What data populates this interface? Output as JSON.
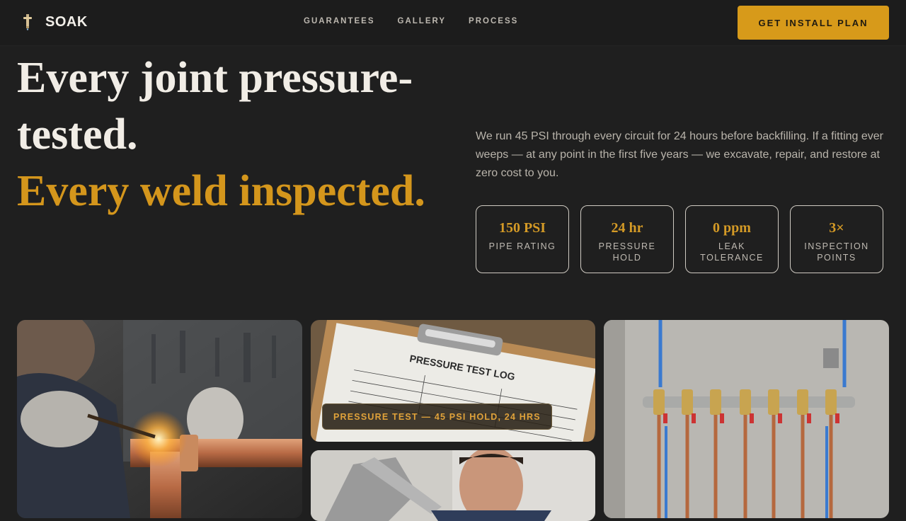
{
  "brand": {
    "name": "SOAK",
    "icon": "tap-icon"
  },
  "nav": [
    {
      "label": "GUARANTEES"
    },
    {
      "label": "GALLERY"
    },
    {
      "label": "PROCESS"
    }
  ],
  "cta": {
    "label": "GET INSTALL PLAN"
  },
  "hero": {
    "headline_line1": "Every joint pressure-tested.",
    "headline_line2": "Every weld inspected.",
    "blurb": "We run 45 PSI through every circuit for 24 hours before backfilling. If a fitting ever weeps — at any point in the first five years — we excavate, repair, and restore at zero cost to you."
  },
  "stats": [
    {
      "value": "150 PSI",
      "label": "PIPE RATING"
    },
    {
      "value": "24 hr",
      "label": "PRESSURE HOLD"
    },
    {
      "value": "0 ppm",
      "label": "LEAK TOLERANCE"
    },
    {
      "value": "3×",
      "label": "INSPECTION POINTS"
    }
  ],
  "gallery": {
    "caption": "PRESSURE TEST — 45 PSI HOLD, 24 HRS",
    "clipboard_title": "PRESSURE TEST LOG"
  },
  "colors": {
    "accent": "#d79a1a",
    "background": "#1f1f1f"
  }
}
